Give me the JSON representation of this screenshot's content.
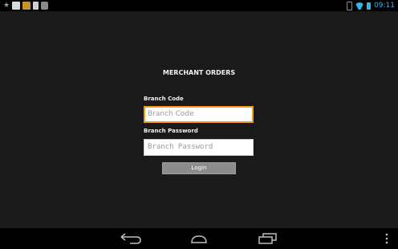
{
  "status_bar": {
    "time": "09:11",
    "left_icons": [
      "star-icon",
      "app-icon",
      "app-icon",
      "sd-card-icon",
      "gallery-icon"
    ],
    "right_icons": [
      "bluetooth-icon",
      "wifi-icon",
      "battery-icon"
    ],
    "accent_color": "#33b5e5"
  },
  "form": {
    "title": "MERCHANT ORDERS",
    "branch_code_label": "Branch Code",
    "branch_code_placeholder": "Branch Code",
    "branch_password_label": "Branch Password",
    "branch_password_placeholder": "Branch Password",
    "login_label": "Login",
    "focus_color": "#f59a1f"
  },
  "nav_bar": {
    "buttons": [
      "back-icon",
      "home-icon",
      "recents-icon",
      "overflow-menu-icon"
    ]
  }
}
